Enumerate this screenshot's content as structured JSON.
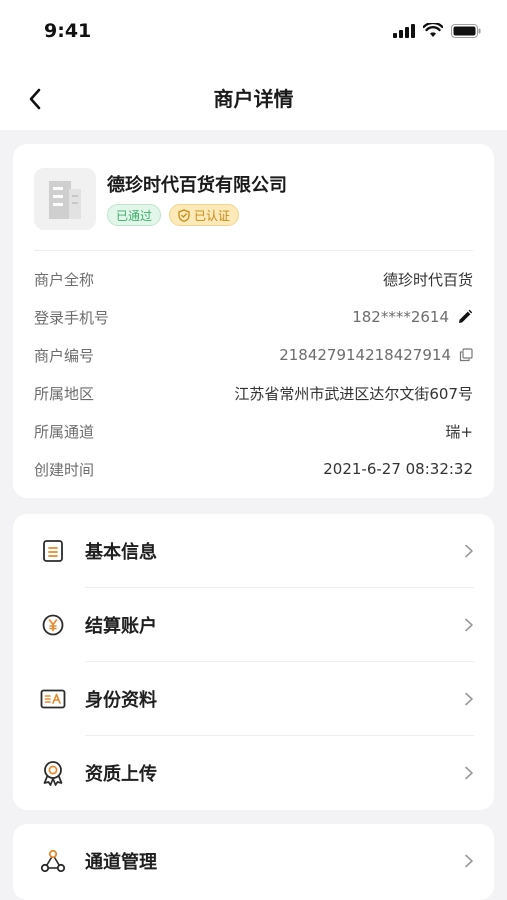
{
  "status_bar": {
    "time": "9:41"
  },
  "nav": {
    "title": "商户详情",
    "back_icon": "chevron-left-icon"
  },
  "merchant": {
    "name": "德珍时代百货有限公司",
    "badges": {
      "passed": "已通过",
      "certified": "已认证"
    },
    "info": [
      {
        "label": "商户全称",
        "value": "德珍时代百货"
      },
      {
        "label": "登录手机号",
        "value": "182****2614"
      },
      {
        "label": "商户编号",
        "value": "218427914218427914"
      },
      {
        "label": "所属地区",
        "value": "江苏省常州市武进区达尔文街607号"
      },
      {
        "label": "所属通道",
        "value": "瑞+"
      },
      {
        "label": "创建时间",
        "value": "2021-6-27 08:32:32"
      }
    ]
  },
  "menu": [
    {
      "label": "基本信息",
      "icon": "document-icon"
    },
    {
      "label": "结算账户",
      "icon": "yen-coin-icon"
    },
    {
      "label": "身份资料",
      "icon": "id-card-icon"
    },
    {
      "label": "资质上传",
      "icon": "certificate-icon"
    }
  ],
  "channel_menu": {
    "label": "通道管理",
    "icon": "network-nodes-icon"
  },
  "colors": {
    "accent": "#e58a2c",
    "badge_green": "#3cae6a",
    "badge_gold": "#c98a12"
  }
}
